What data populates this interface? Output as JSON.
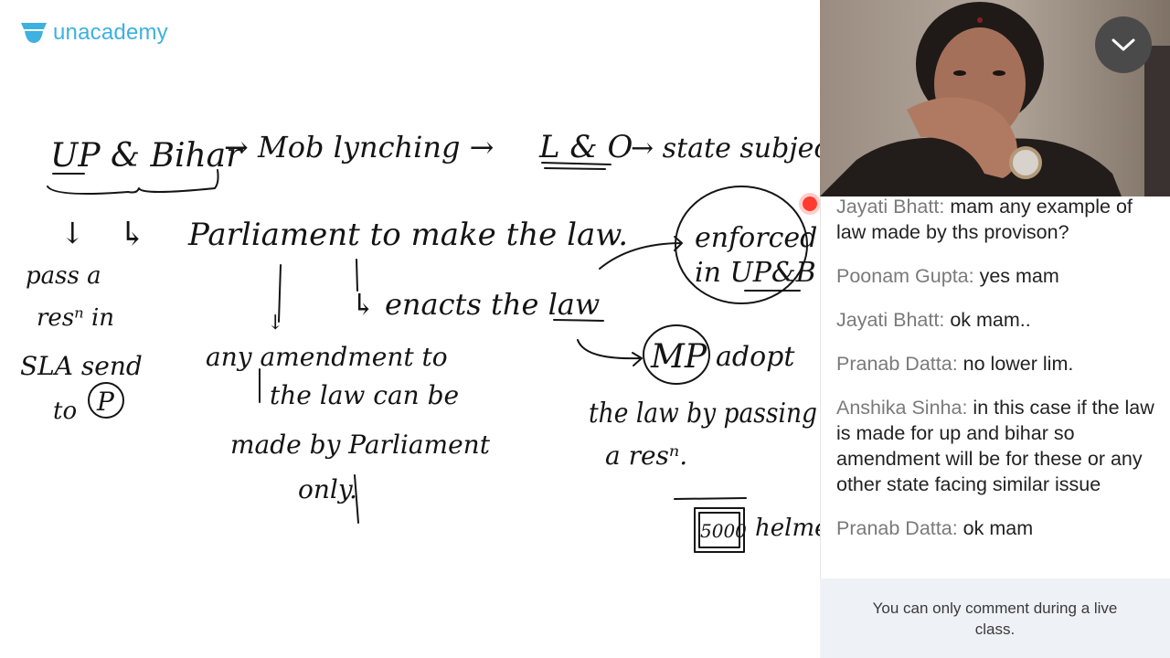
{
  "brand": {
    "name": "unacademy",
    "color": "#3db1e0"
  },
  "whiteboard": {
    "notes": [
      "UP & Bihar",
      "→ Mob lynching →",
      "L & O",
      "→ state subject",
      "↓",
      "↳",
      "Parliament to make the law.",
      "pass a",
      "resⁿ in",
      "SLA send",
      "to",
      "P",
      "↓",
      "↳ enacts the law",
      "enforced",
      "in UP&B",
      "any amendment to",
      "the law can be",
      "made by Parliament",
      "only.",
      "MP",
      "adopt",
      "the law by passing",
      "a resⁿ.",
      "5000",
      "helmet"
    ]
  },
  "video": {
    "collapse_icon": "chevron-down-icon"
  },
  "chat": {
    "messages": [
      {
        "author": "Jayati Bhatt:",
        "text": "mam any example of law made by ths provison?"
      },
      {
        "author": "Poonam Gupta:",
        "text": "yes mam"
      },
      {
        "author": "Jayati Bhatt:",
        "text": "ok mam.."
      },
      {
        "author": "Pranab Datta:",
        "text": "no lower lim."
      },
      {
        "author": "Anshika Sinha:",
        "text": "in this case if the law is made for up and bihar so amendment will be for these or any other state facing similar issue"
      },
      {
        "author": "Pranab Datta:",
        "text": "ok mam"
      }
    ],
    "notice": "You can only comment during a live class."
  },
  "colors": {
    "ink": "#141414",
    "author": "#7a7a7a",
    "notice_bg": "#eef1f5",
    "live_dot": "#ff3b30"
  }
}
